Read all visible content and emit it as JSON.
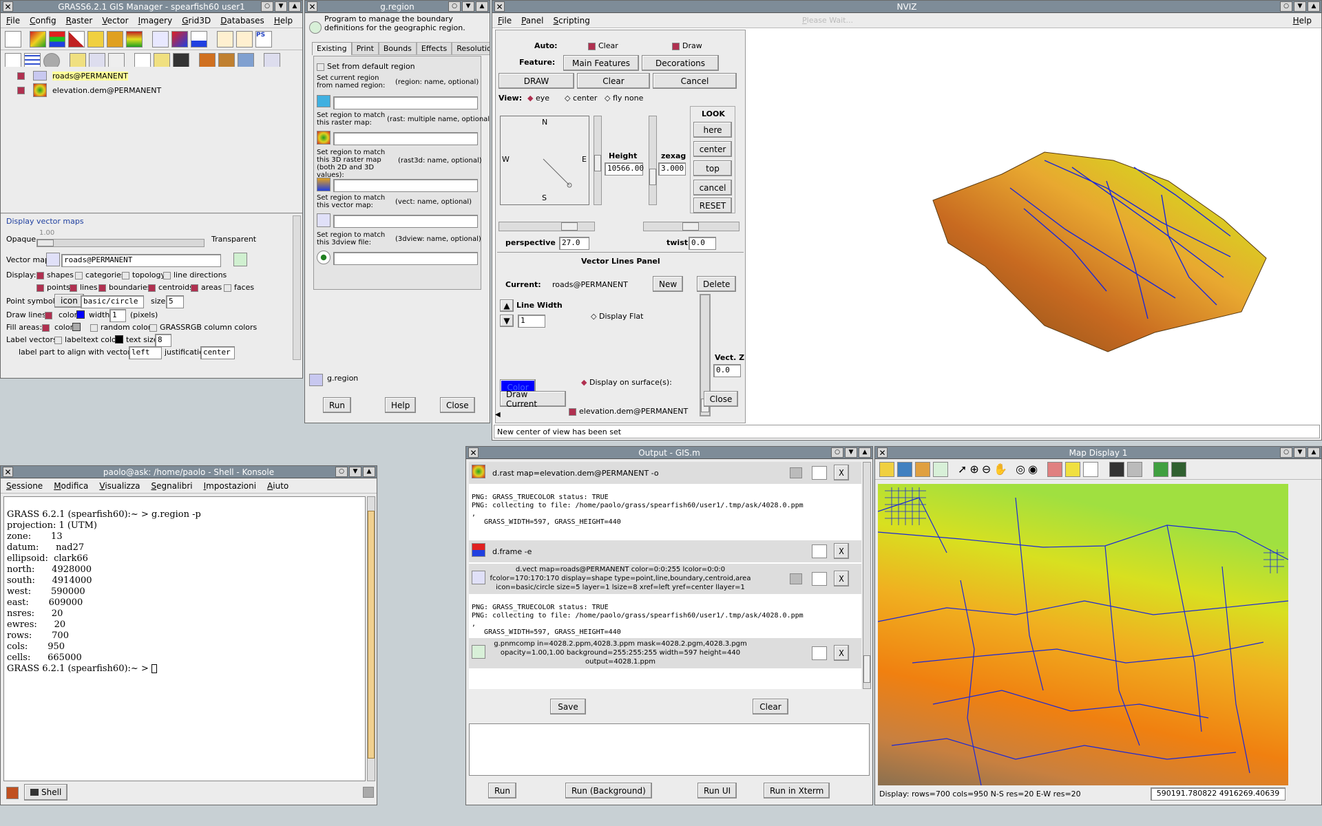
{
  "desktop": {
    "background": "#c8d0d4"
  },
  "gis_manager": {
    "title": "GRASS6.2.1 GIS Manager - spearfish60 user1",
    "menu": [
      "File",
      "Config",
      "Raster",
      "Vector",
      "Imagery",
      "Grid3D",
      "Databases",
      "Help"
    ],
    "layers": [
      "roads@PERMANENT",
      "elevation.dem@PERMANENT"
    ],
    "panel": {
      "header": "Display vector maps",
      "opacity_value": "1.00",
      "opaque": "Opaque",
      "transparent": "Transparent",
      "vector_map_label": "Vector map:",
      "vector_map_value": "roads@PERMANENT",
      "display_label": "Display:",
      "shapes": "shapes",
      "categories": "categories",
      "topology": "topology",
      "line_directions": "line directions",
      "points": "points",
      "lines": "lines",
      "boundaries": "boundaries",
      "centroids": "centroids",
      "areas": "areas",
      "faces": "faces",
      "point_symbols_label": "Point symbols:",
      "icon_btn": "icon",
      "icon_value": "basic/circle",
      "size_label": "size",
      "size_value": "5",
      "draw_lines_label": "Draw lines:",
      "color_label": "color",
      "width_label": "width",
      "width_value": "1",
      "pixels": "(pixels)",
      "fill_areas_label": "Fill areas:",
      "random_colors": "random colors",
      "grassrgb": "GRASSRGB column colors",
      "label_vectors_label": "Label vectors:",
      "label": "label",
      "text_color": "text color",
      "text_size": "text size",
      "text_size_value": "8",
      "align_label": "label part to align with vector point",
      "align_value": "left",
      "justification": "justification",
      "justification_value": "center"
    }
  },
  "gregion": {
    "title": "g.region",
    "description": "Program to manage the boundary definitions for the geographic region.",
    "tabs": [
      "Existing",
      "Print",
      "Bounds",
      "Effects",
      "Resolution"
    ],
    "set_default": "Set from default region",
    "opt1_desc": "Set current region from named region:",
    "opt1_key": "(region:  name, optional)",
    "opt2_desc": "Set region to match this raster map:",
    "opt2_key": "(rast: multiple name, optional)",
    "opt3_desc": "Set region to match this 3D raster map (both 2D and 3D values):",
    "opt3_key": "(rast3d:  name, optional)",
    "opt4_desc": "Set region to match this vector map:",
    "opt4_key": "(vect:  name, optional)",
    "opt5_desc": "Set region to match this 3dview file:",
    "opt5_key": "(3dview:  name, optional)",
    "command": "g.region",
    "run": "Run",
    "help": "Help",
    "close": "Close"
  },
  "nviz": {
    "title": "NVIZ",
    "menu": [
      "File",
      "Panel",
      "Scripting"
    ],
    "help": "Help",
    "auto": "Auto:",
    "clear_chk": "Clear",
    "draw_chk": "Draw",
    "feature": "Feature:",
    "main_features": "Main Features",
    "decorations": "Decorations",
    "draw_btn": "DRAW",
    "clear_btn": "Clear",
    "cancel_btn": "Cancel",
    "view": "View:",
    "eye": "eye",
    "center": "center",
    "fly_none": "fly none",
    "compass": {
      "n": "N",
      "s": "S",
      "e": "E",
      "w": "W"
    },
    "height_label": "Height",
    "height_value": "10566.00",
    "zexag_label": "zexag",
    "zexag_value": "3.000",
    "look": "LOOK",
    "look_here": "here",
    "look_center": "center",
    "look_top": "top",
    "look_cancel": "cancel",
    "look_reset": "RESET",
    "perspective_label": "perspective",
    "perspective_value": "27.0",
    "twist_label": "twist",
    "twist_value": "0.0",
    "vector_panel_title": "Vector Lines Panel",
    "current_label": "Current:",
    "current_value": "roads@PERMANENT",
    "new_btn": "New",
    "delete_btn": "Delete",
    "line_width": "Line Width",
    "line_width_value": "1",
    "display_flat": "Display Flat",
    "color_btn": "Color",
    "display_on_surface": "Display on surface(s):",
    "surface": "elevation.dem@PERMANENT",
    "vectz_label": "Vect. Z",
    "vectz_value": "0.0",
    "draw_current": "Draw Current",
    "close_btn": "Close",
    "status": "New center of view has been set",
    "please_wait": "Please Wait...",
    "vector_color": "#0000ff"
  },
  "konsole": {
    "title": "paolo@ask: /home/paolo - Shell - Konsole",
    "menu": [
      "Sessione",
      "Modifica",
      "Visualizza",
      "Segnalibri",
      "Impostazioni",
      "Aiuto"
    ],
    "lines": [
      "GRASS 6.2.1 (spearfish60):~ > g.region -p",
      "projection: 1 (UTM)",
      "zone:       13",
      "datum:      nad27",
      "ellipsoid:  clark66",
      "north:      4928000",
      "south:      4914000",
      "west:       590000",
      "east:       609000",
      "nsres:      20",
      "ewres:      20",
      "rows:       700",
      "cols:       950",
      "cells:      665000",
      "GRASS 6.2.1 (spearfish60):~ > "
    ],
    "tab": "Shell"
  },
  "output": {
    "title": "Output - GIS.m",
    "cmd1": "d.rast map=elevation.dem@PERMANENT -o",
    "out1": [
      "PNG: GRASS_TRUECOLOR status: TRUE",
      "PNG: collecting to file: /home/paolo/grass/spearfish60/user1/.tmp/ask/4028.0.ppm",
      ",",
      "   GRASS_WIDTH=597, GRASS_HEIGHT=440"
    ],
    "cmd2": "d.frame -e",
    "cmd3": [
      "d.vect map=roads@PERMANENT color=0:0:255 lcolor=0:0:0",
      "fcolor=170:170:170 display=shape type=point,line,boundary,centroid,area",
      "icon=basic/circle size=5 layer=1 lsize=8 xref=left yref=center llayer=1"
    ],
    "out3": [
      "PNG: GRASS_TRUECOLOR status: TRUE",
      "PNG: collecting to file: /home/paolo/grass/spearfish60/user1/.tmp/ask/4028.0.ppm",
      ",",
      "   GRASS_WIDTH=597, GRASS_HEIGHT=440"
    ],
    "cmd4": [
      "g.pnmcomp in=4028.2.ppm,4028.3.ppm mask=4028.2.pgm,4028.3.pgm",
      "opacity=1.00,1.00 background=255:255:255 width=597 height=440",
      "output=4028.1.ppm"
    ],
    "x": "X",
    "save": "Save",
    "clear": "Clear",
    "run": "Run",
    "run_bg": "Run (Background)",
    "run_ui": "Run UI",
    "run_xterm": "Run in Xterm"
  },
  "mapdisplay": {
    "title": "Map Display 1",
    "status": "Display: rows=700 cols=950 N-S res=20 E-W res=20",
    "coords": "590191.780822 4916269.40639"
  }
}
